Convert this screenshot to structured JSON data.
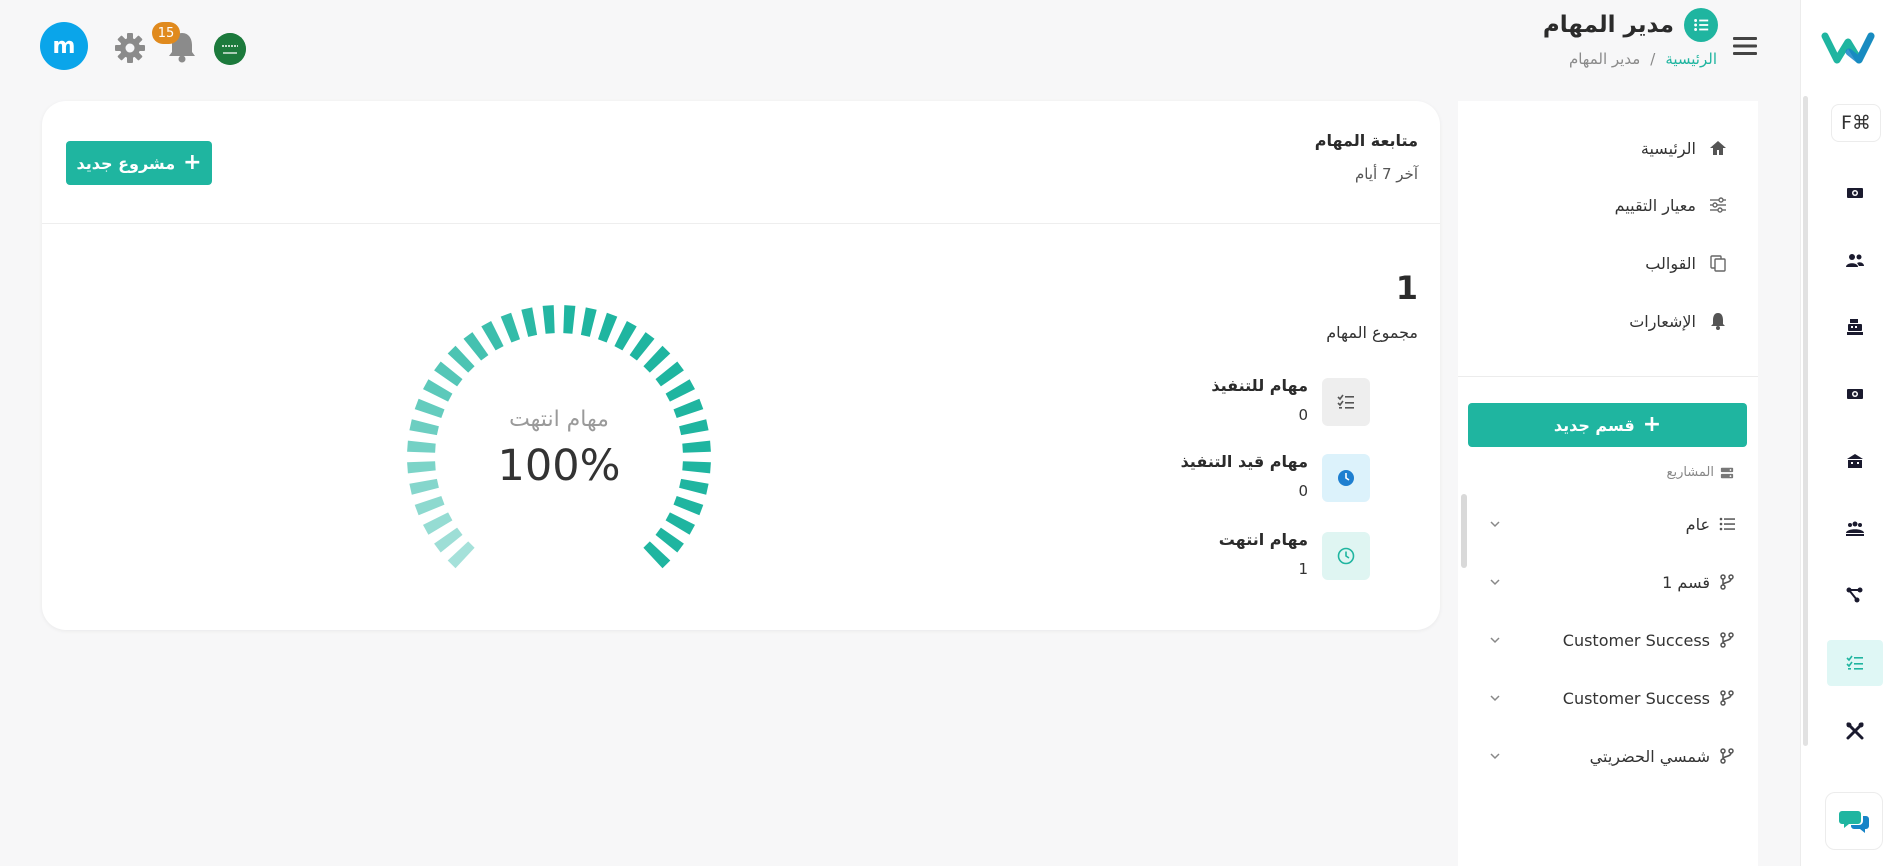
{
  "header": {
    "title": "مدير المهام",
    "breadcrumb_home": "الرئيسية",
    "breadcrumb_separator": "/",
    "breadcrumb_current": "مدير المهام",
    "avatar_letter": "m",
    "notification_count": "15",
    "language_flag_icon": "saudi-flag-icon"
  },
  "rail": {
    "shortcut_label": "F⌘",
    "items": [
      "money-icon",
      "users-icon",
      "cash-register-icon",
      "money-icon",
      "building-icon",
      "team-icon",
      "workflow-icon",
      "task-list-icon",
      "tools-icon"
    ],
    "active_item": "task-list-icon",
    "chat_icon": "chat-icon"
  },
  "sidebar": {
    "nav": [
      {
        "label": "الرئيسية",
        "icon": "home-icon"
      },
      {
        "label": "معيار التقييم",
        "icon": "sliders-icon"
      },
      {
        "label": "القوالب",
        "icon": "copy-icon"
      },
      {
        "label": "الإشعارات",
        "icon": "bell-icon"
      }
    ],
    "new_section_label": "قسم جديد",
    "projects_label": "المشاريع",
    "projects": [
      {
        "label": "عام",
        "icon": "list-icon"
      },
      {
        "label": "قسم 1",
        "icon": "branch-icon"
      },
      {
        "label": "Customer Success",
        "icon": "branch-icon"
      },
      {
        "label": "Customer Success",
        "icon": "branch-icon"
      },
      {
        "label": "شمسي الحضريتي",
        "icon": "branch-icon"
      }
    ]
  },
  "card": {
    "title": "متابعة المهام",
    "subtitle": "آخر 7 أيام",
    "new_project_label": "مشروع جديد",
    "total_count": "1",
    "total_label": "مجموع المهام",
    "stats": [
      {
        "label": "مهام للتنفيذ",
        "value": "0",
        "icon": "task-list-icon",
        "bg": "#eeeeee",
        "fg": "#555555"
      },
      {
        "label": "مهام قيد التنفيذ",
        "value": "0",
        "icon": "clock-filled-icon",
        "bg": "#dcf2fb",
        "fg": "#1e7fd0"
      },
      {
        "label": "مهام انتهت",
        "value": "1",
        "icon": "clock-icon",
        "bg": "#dff5f2",
        "fg": "#1fb5a0"
      }
    ],
    "gauge_label": "مهام انتهت",
    "gauge_value": "100%",
    "gauge_fraction": 1.0
  },
  "colors": {
    "accent": "#1fb5a0",
    "avatar": "#0aa5ea",
    "badge": "#e08a1e"
  }
}
